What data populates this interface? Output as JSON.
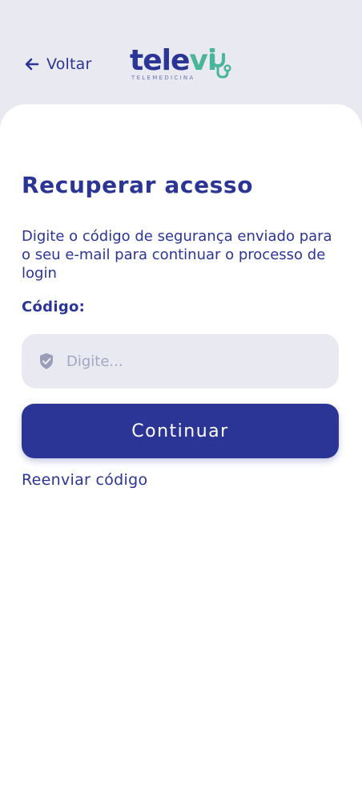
{
  "header": {
    "back_label": "Voltar",
    "logo": {
      "word_main": "tele",
      "word_accent": "vi",
      "subtitle": "TELEMEDICINA"
    }
  },
  "main": {
    "title": "Recuperar acesso",
    "description": "Digite o código de segurança enviado para o seu e-mail para continuar o processo de login",
    "code_label": "Código:",
    "code_input": {
      "value": "",
      "placeholder": "Digite..."
    },
    "continue_label": "Continuar",
    "resend_label": "Reenviar código"
  },
  "colors": {
    "primary": "#2b3595",
    "accent": "#49b59c",
    "background": "#e9e9f2",
    "card": "#ffffff",
    "placeholder": "#a4a7c4"
  },
  "icons": {
    "back": "arrow-left-icon",
    "input": "shield-check-icon",
    "logo": "stethoscope-icon"
  }
}
